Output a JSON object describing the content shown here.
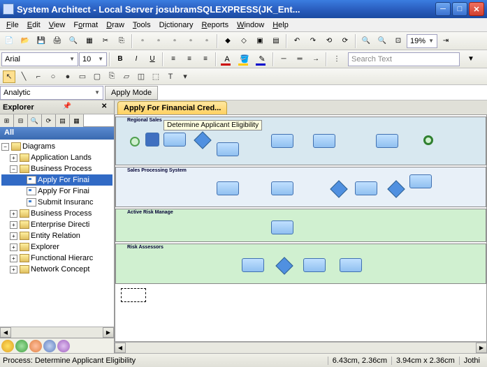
{
  "window": {
    "title": "System Architect - Local Server josubramSQLEXPRESS(JK_Ent..."
  },
  "menu": {
    "file": "File",
    "edit": "Edit",
    "view": "View",
    "format": "Format",
    "draw": "Draw",
    "tools": "Tools",
    "dictionary": "Dictionary",
    "reports": "Reports",
    "window": "Window",
    "help": "Help"
  },
  "toolbar": {
    "font_name": "Arial",
    "font_size": "10",
    "bold": "B",
    "italic": "I",
    "underline": "U",
    "zoom": "19%",
    "search_placeholder": "Search Text"
  },
  "mode": {
    "dropdown": "Analytic",
    "apply": "Apply Mode"
  },
  "explorer": {
    "title": "Explorer",
    "all": "All",
    "root": "Diagrams",
    "items": [
      {
        "label": "Application Lands"
      },
      {
        "label": "Business Process"
      },
      {
        "label": "Apply For Finai",
        "selected": true
      },
      {
        "label": "Apply For Finai"
      },
      {
        "label": "Submit Insuranc"
      },
      {
        "label": "Business Process"
      },
      {
        "label": "Enterprise Directi"
      },
      {
        "label": "Entity Relation"
      },
      {
        "label": "Explorer"
      },
      {
        "label": "Functional Hierarc"
      },
      {
        "label": "Network Concept"
      }
    ]
  },
  "document": {
    "tab": "Apply For Financial Cred...",
    "tooltip": "Determine Applicant Eligibility",
    "lanes": [
      "Regional Sales",
      "Sales Processing System",
      "Active Risk Manage",
      "Risk Assessors"
    ]
  },
  "status": {
    "left": "Process: Determine Applicant Eligibility",
    "coord1": "6.43cm, 2.36cm",
    "coord2": "3.94cm x 2.36cm",
    "user": "Jothi"
  }
}
